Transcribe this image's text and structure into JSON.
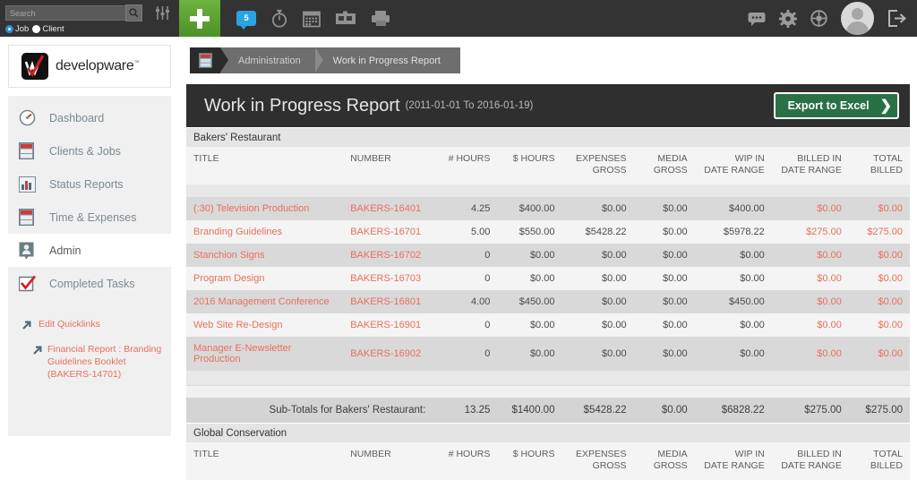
{
  "topbar": {
    "search": {
      "placeholder": "Search",
      "value": ""
    },
    "search_icon": "search-icon",
    "filters_icon": "sliders-icon",
    "radios": [
      {
        "label": "Job",
        "selected": true
      },
      {
        "label": "Client",
        "selected": false
      }
    ],
    "add_icon": "plus-icon",
    "notification_count": "5",
    "icons": [
      "comment-bubble-icon",
      "stopwatch-icon",
      "calendar-icon",
      "timecard-icon",
      "printer-icon"
    ],
    "right_icons": [
      "chat-icon",
      "gear-icon",
      "help-globe-icon",
      "avatar",
      "logout-icon"
    ]
  },
  "sidebar": {
    "logo_text": "developware",
    "logo_tm": "™",
    "items": [
      {
        "label": "Dashboard",
        "icon": "gauge-icon",
        "active": false
      },
      {
        "label": "Clients & Jobs",
        "icon": "cabinet-icon",
        "active": false
      },
      {
        "label": "Status Reports",
        "icon": "bar-chart-icon",
        "active": false
      },
      {
        "label": "Time & Expenses",
        "icon": "cabinet-icon",
        "active": false
      },
      {
        "label": "Admin",
        "icon": "user-badge-icon",
        "active": true
      },
      {
        "label": "Completed Tasks",
        "icon": "check-box-icon",
        "active": false
      }
    ],
    "quicklinks": {
      "edit_label": "Edit Quicklinks",
      "items": [
        {
          "label": "Financial Report : Branding Guidelines Booklet (BAKERS-14701)"
        }
      ]
    }
  },
  "breadcrumb": {
    "icon": "cabinet-icon",
    "items": [
      "Administration",
      "Work in Progress Report"
    ]
  },
  "header": {
    "title": "Work in Progress Report",
    "date_range": "(2011-01-01 To 2016-01-19)",
    "export_button": "Export to Excel",
    "export_chevron": "❯"
  },
  "table": {
    "columns": [
      "TITLE",
      "NUMBER",
      "# HOURS",
      "$ HOURS",
      "EXPENSES GROSS",
      "MEDIA GROSS",
      "WIP IN DATE RANGE",
      "BILLED IN DATE RANGE",
      "TOTAL BILLED"
    ],
    "columns_split": [
      {
        "l1": "TITLE",
        "l2": ""
      },
      {
        "l1": "NUMBER",
        "l2": ""
      },
      {
        "l1": "# HOURS",
        "l2": ""
      },
      {
        "l1": "$ HOURS",
        "l2": ""
      },
      {
        "l1": "EXPENSES",
        "l2": "GROSS"
      },
      {
        "l1": "MEDIA",
        "l2": "GROSS"
      },
      {
        "l1": "WIP IN",
        "l2": "DATE RANGE"
      },
      {
        "l1": "BILLED IN",
        "l2": "DATE RANGE"
      },
      {
        "l1": "TOTAL",
        "l2": "BILLED"
      }
    ],
    "groups": [
      {
        "name": "Bakers' Restaurant",
        "rows": [
          {
            "title": "(:30) Television Production",
            "number": "BAKERS-16401",
            "hours": "4.25",
            "dollar_hours": "$400.00",
            "expenses_gross": "$0.00",
            "media_gross": "$0.00",
            "wip": "$400.00",
            "billed": "$0.00",
            "total_billed": "$0.00"
          },
          {
            "title": "Branding Guidelines",
            "number": "BAKERS-16701",
            "hours": "5.00",
            "dollar_hours": "$550.00",
            "expenses_gross": "$5428.22",
            "media_gross": "$0.00",
            "wip": "$5978.22",
            "billed": "$275.00",
            "total_billed": "$275.00"
          },
          {
            "title": "Stanchion Signs",
            "number": "BAKERS-16702",
            "hours": "0",
            "dollar_hours": "$0.00",
            "expenses_gross": "$0.00",
            "media_gross": "$0.00",
            "wip": "$0.00",
            "billed": "$0.00",
            "total_billed": "$0.00"
          },
          {
            "title": "Program Design",
            "number": "BAKERS-16703",
            "hours": "0",
            "dollar_hours": "$0.00",
            "expenses_gross": "$0.00",
            "media_gross": "$0.00",
            "wip": "$0.00",
            "billed": "$0.00",
            "total_billed": "$0.00"
          },
          {
            "title": "2016 Management Conference",
            "number": "BAKERS-16801",
            "hours": "4.00",
            "dollar_hours": "$450.00",
            "expenses_gross": "$0.00",
            "media_gross": "$0.00",
            "wip": "$450.00",
            "billed": "$0.00",
            "total_billed": "$0.00"
          },
          {
            "title": "Web Site Re-Design",
            "number": "BAKERS-16901",
            "hours": "0",
            "dollar_hours": "$0.00",
            "expenses_gross": "$0.00",
            "media_gross": "$0.00",
            "wip": "$0.00",
            "billed": "$0.00",
            "total_billed": "$0.00"
          },
          {
            "title": "Manager E-Newsletter Production",
            "number": "BAKERS-16902",
            "hours": "0",
            "dollar_hours": "$0.00",
            "expenses_gross": "$0.00",
            "media_gross": "$0.00",
            "wip": "$0.00",
            "billed": "$0.00",
            "total_billed": "$0.00"
          }
        ],
        "subtotal": {
          "label": "Sub-Totals for Bakers' Restaurant:",
          "hours": "13.25",
          "dollar_hours": "$1400.00",
          "expenses_gross": "$5428.22",
          "media_gross": "$0.00",
          "wip": "$6828.22",
          "billed": "$275.00",
          "total_billed": "$275.00"
        }
      },
      {
        "name": "Global Conservation",
        "rows": [],
        "subtotal": null
      }
    ]
  }
}
